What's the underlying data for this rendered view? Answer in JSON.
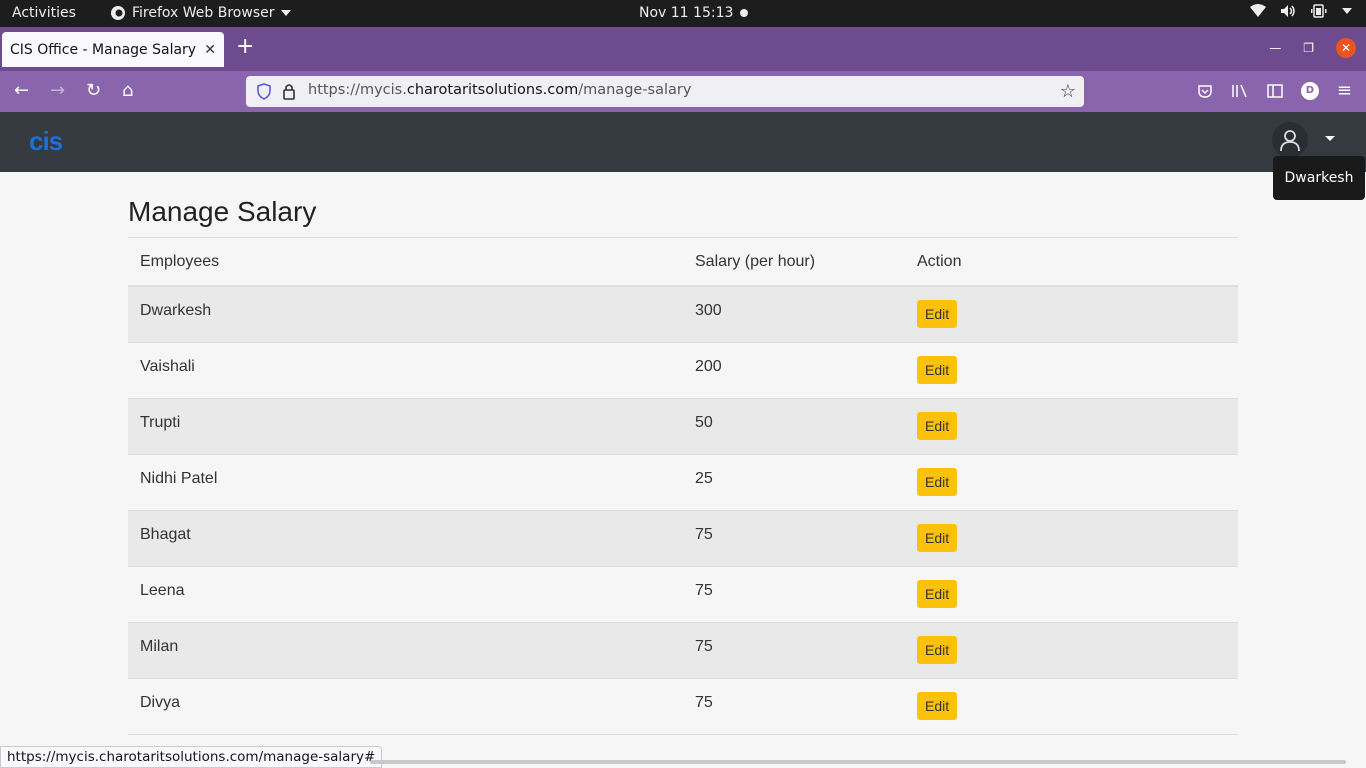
{
  "system_bar": {
    "activities": "Activities",
    "app_name": "Firefox Web Browser",
    "clock": "Nov 11  15:13"
  },
  "browser": {
    "tab_title": "CIS Office - Manage Salary",
    "url_scheme": "https://mycis.",
    "url_domain": "charotaritsolutions.com",
    "url_path": "/manage-salary",
    "status_url": "https://mycis.charotaritsolutions.com/manage-salary#",
    "profile_initial": "D"
  },
  "app": {
    "logo": "cis",
    "user_tooltip": "Dwarkesh"
  },
  "page": {
    "title": "Manage Salary",
    "columns": [
      "Employees",
      "Salary (per hour)",
      "Action"
    ],
    "rows": [
      {
        "name": "Dwarkesh",
        "salary": "300",
        "action": "Edit"
      },
      {
        "name": "Vaishali",
        "salary": "200",
        "action": "Edit"
      },
      {
        "name": "Trupti",
        "salary": "50",
        "action": "Edit"
      },
      {
        "name": "Nidhi Patel",
        "salary": "25",
        "action": "Edit"
      },
      {
        "name": "Bhagat",
        "salary": "75",
        "action": "Edit"
      },
      {
        "name": "Leena",
        "salary": "75",
        "action": "Edit"
      },
      {
        "name": "Milan",
        "salary": "75",
        "action": "Edit"
      },
      {
        "name": "Divya",
        "salary": "75",
        "action": "Edit"
      }
    ]
  },
  "colors": {
    "tab_strip": "#6e4a8f",
    "toolbar": "#8a65ad",
    "app_header": "#343a40",
    "edit_button": "#fcc10b"
  }
}
